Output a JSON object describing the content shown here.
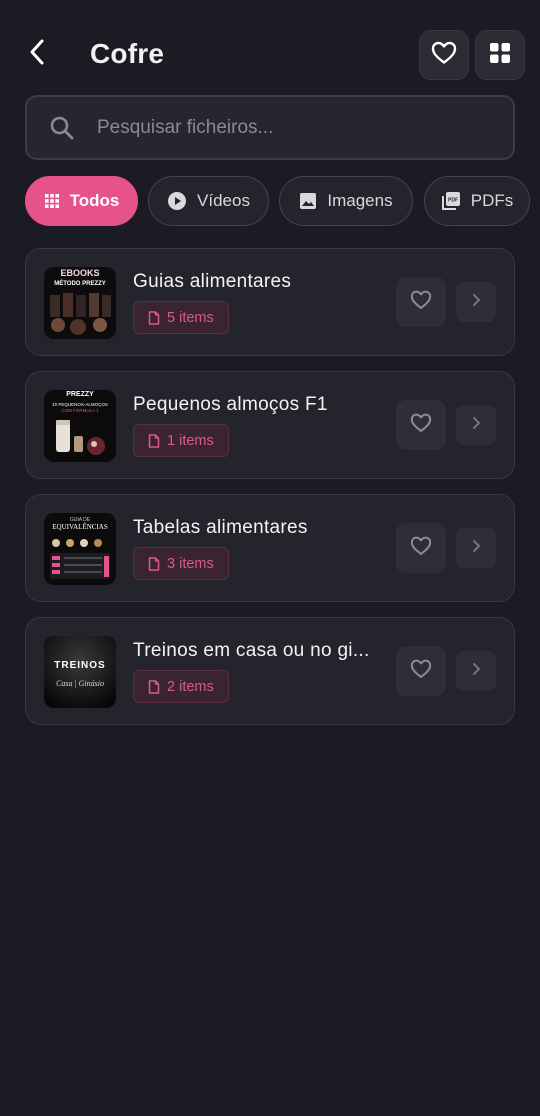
{
  "header": {
    "title": "Cofre"
  },
  "search": {
    "placeholder": "Pesquisar ficheiros..."
  },
  "filters": [
    {
      "label": "Todos",
      "active": true
    },
    {
      "label": "Vídeos",
      "active": false
    },
    {
      "label": "Imagens",
      "active": false
    },
    {
      "label": "PDFs",
      "active": false
    }
  ],
  "folders": [
    {
      "title": "Guias alimentares",
      "count": "5 items",
      "thumb_lines": [
        "EBOOKS",
        "MÉTODO PREZZY"
      ]
    },
    {
      "title": "Pequenos almoços F1",
      "count": "1 items",
      "thumb_lines": [
        "PREZZY",
        "10 PEQUENOS-ALMOÇOS",
        "COM FÓRMULA 1"
      ]
    },
    {
      "title": "Tabelas alimentares",
      "count": "3 items",
      "thumb_lines": [
        "GUIA DE",
        "EQUIVALÊNCIAS"
      ]
    },
    {
      "title": "Treinos em casa ou no gi...",
      "count": "2 items",
      "thumb_lines": [
        "TREINOS",
        "Casa | Ginásio"
      ]
    }
  ],
  "colors": {
    "accent": "#e6538a",
    "background": "#1b1b23",
    "card": "#24242c"
  }
}
